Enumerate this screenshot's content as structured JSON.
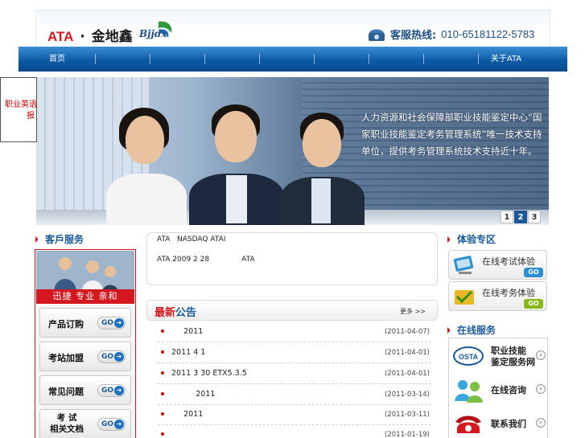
{
  "header": {
    "logo_ata": "ATA",
    "logo_dot": "·",
    "logo_brand": "金地鑫",
    "logo_mark": "Bjjdx",
    "hotline_label": "客服热线:",
    "hotline_number": "010-65181122-5783"
  },
  "nav": {
    "items": [
      "首页",
      "",
      "",
      "",
      "",
      "",
      "",
      "",
      "关于ATA"
    ]
  },
  "side_popup": {
    "line1": "职业英语",
    "line2": "报"
  },
  "banner": {
    "text": "人力资源和社会保障部职业技能鉴定中心“国家职业技能鉴定考务管理系统”唯一技术支持单位，提供考务管理系统技术支持近十年。",
    "pages": [
      "1",
      "2",
      "3"
    ],
    "active_page": "2"
  },
  "customer_service": {
    "title": "客戶服务",
    "strip": "迅捷 专业 亲和",
    "buttons": [
      {
        "label": "产品订购",
        "go": "GO"
      },
      {
        "label": "考站加盟",
        "go": "GO"
      },
      {
        "label": "常见问题",
        "go": "GO"
      },
      {
        "label_line1": "考  试",
        "label_line2": "相关文档",
        "go": "GO"
      }
    ]
  },
  "news": {
    "line1": "ATA   NASDAQ ATAI",
    "line2": "ATA 2009 2 28              ATA"
  },
  "notice": {
    "title_a": "最新",
    "title_b": "公告",
    "more": "更多 >>",
    "rows": [
      {
        "text": "     2011",
        "date": "(2011-04-07)"
      },
      {
        "text": "2011 4 1",
        "date": "(2011-04-01)"
      },
      {
        "text": "2011 3 30 ETX5.3.5",
        "date": "(2011-04-01)"
      },
      {
        "text": "          2011",
        "date": "(2011-03-14)"
      },
      {
        "text": "     2011",
        "date": "(2011-03-11)"
      },
      {
        "text": "",
        "date": "(2011-01-19)"
      }
    ]
  },
  "experience": {
    "title": "体验专区",
    "items": [
      {
        "label": "在线考试体验",
        "go": "GO",
        "color": "#2b8fd6"
      },
      {
        "label": "在线考务体验",
        "go": "GO",
        "color": "#86b817"
      }
    ]
  },
  "online_service": {
    "title": "在线服务",
    "items": [
      {
        "line1": "职业技能",
        "line2": "鉴定服务网",
        "icon": "osta-logo-icon",
        "icon_text": "OSTA"
      },
      {
        "line1": "在线咨询",
        "line2": "",
        "icon": "consult-people-icon"
      },
      {
        "line1": "联系我们",
        "line2": "",
        "icon": "contact-phone-icon"
      }
    ]
  },
  "colors": {
    "brand_red": "#d5181f",
    "brand_blue": "#1a5a9a",
    "nav_blue": "#0d5aa6"
  }
}
